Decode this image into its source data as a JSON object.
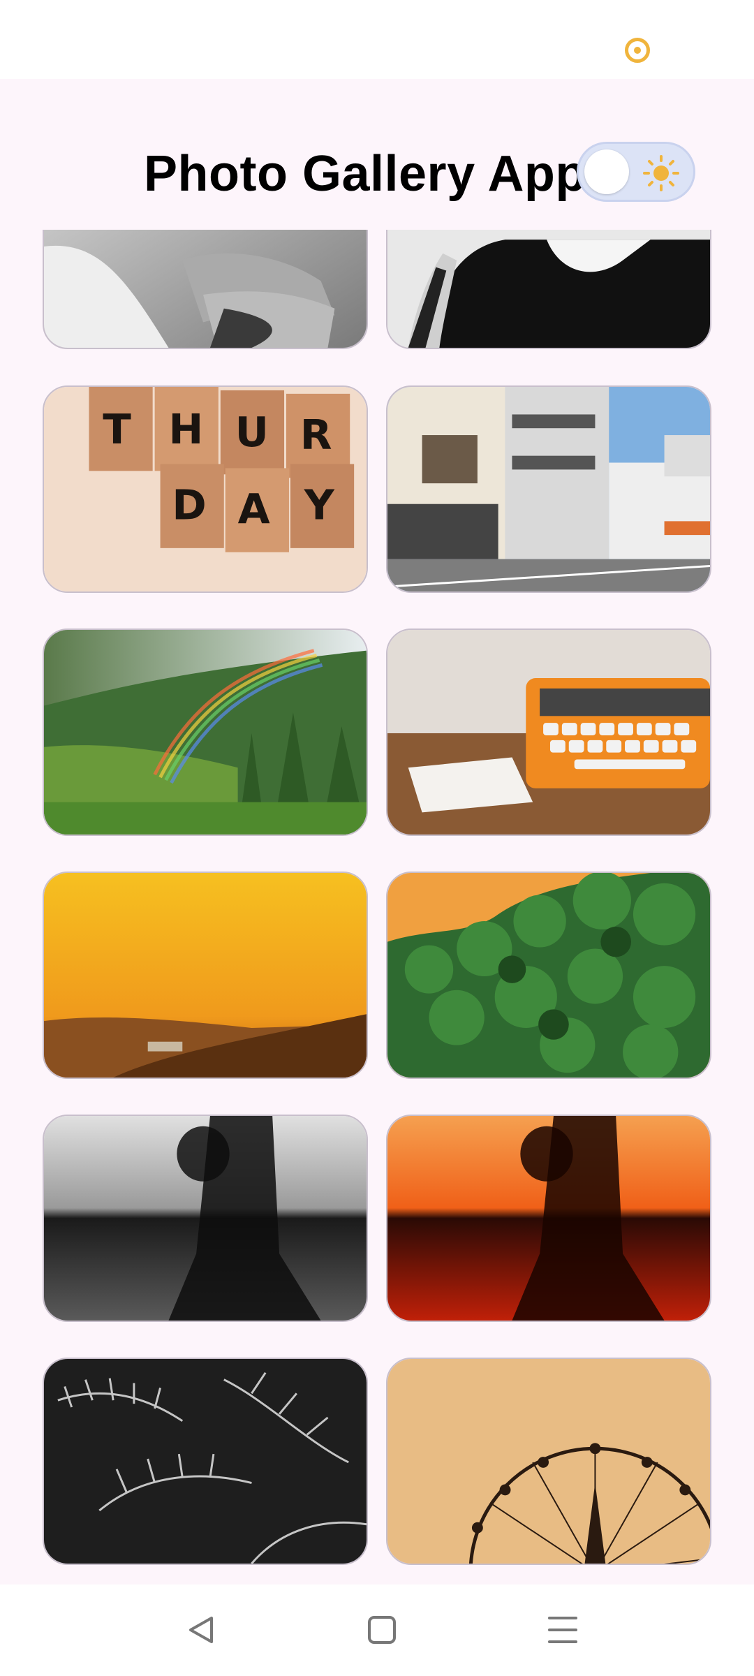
{
  "header": {
    "title": "Photo Gallery App",
    "theme_toggle": {
      "state": "light",
      "icon": "sun-icon"
    }
  },
  "status_bar": {
    "icon": "focus-indicator-icon",
    "accent": "#f0b43c"
  },
  "gallery": {
    "photos": [
      {
        "name": "photo-hands-monochrome",
        "subject": "hands monochrome"
      },
      {
        "name": "photo-woman-black-dress",
        "subject": "woman in black dress"
      },
      {
        "name": "photo-thursday-blocks",
        "subject": "wooden letter blocks",
        "letters_row1": "THUR",
        "letters_row2": "DAY"
      },
      {
        "name": "photo-street-buildings",
        "subject": "street with buildings"
      },
      {
        "name": "photo-rainbow-forest",
        "subject": "rainbow over forest hills"
      },
      {
        "name": "photo-orange-typewriter",
        "subject": "orange typewriter on desk"
      },
      {
        "name": "photo-sunset-hills",
        "subject": "sunset over hills"
      },
      {
        "name": "photo-ivy-wall",
        "subject": "ivy on wall"
      },
      {
        "name": "photo-motion-blur-bw",
        "subject": "motion blur figure monochrome"
      },
      {
        "name": "photo-motion-blur-orange",
        "subject": "motion blur figure orange"
      },
      {
        "name": "photo-leaves-bw",
        "subject": "leaves monochrome"
      },
      {
        "name": "photo-ferris-wheel",
        "subject": "ferris wheel at sunset"
      }
    ]
  },
  "navbar": {
    "back": "back-icon",
    "home": "home-icon",
    "menu": "menu-icon"
  }
}
